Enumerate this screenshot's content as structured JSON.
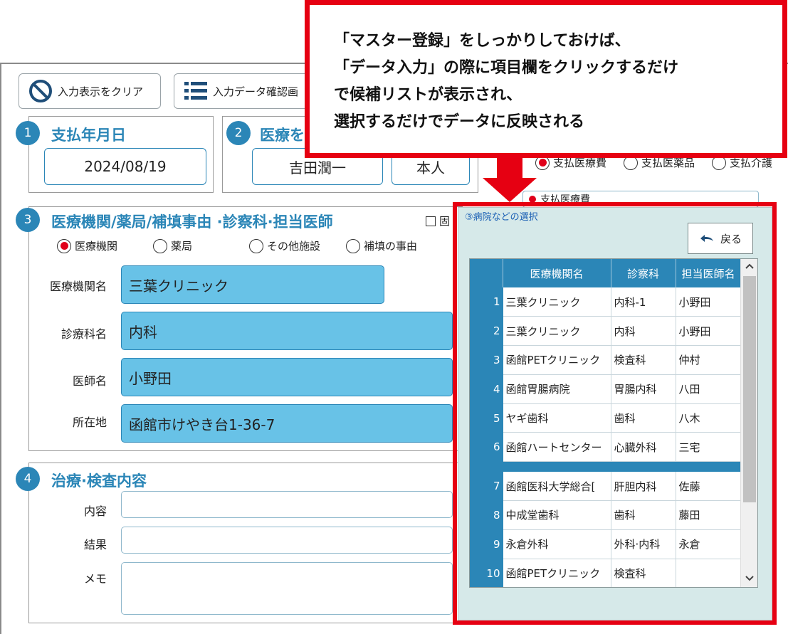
{
  "toolbar": {
    "clear_label": "入力表示をクリア",
    "confirm_label": "入力データ確認画"
  },
  "section1": {
    "num": "1",
    "title": "支払年月日",
    "date": "2024/08/19"
  },
  "section2": {
    "num": "2",
    "title": "医療を",
    "person": "吉田潤一",
    "relation": "本人"
  },
  "payment": {
    "options": [
      "支払医療費",
      "支払医薬品",
      "支払介護"
    ],
    "selected_label": "支払医療費"
  },
  "section3": {
    "num": "3",
    "title": "医療機関/薬局/補填事由 ·診察科·担当医師",
    "checkbox_label": "固",
    "radios": [
      "医療機関",
      "薬局",
      "その他施設",
      "補填の事由"
    ],
    "selected_radio": "医療機関",
    "fields": [
      {
        "label": "医療機関名",
        "value": "三葉クリニック"
      },
      {
        "label": "診療科名",
        "value": "内科"
      },
      {
        "label": "医師名",
        "value": "小野田"
      },
      {
        "label": "所在地",
        "value": "函館市けやき台1-36-7"
      }
    ]
  },
  "section4": {
    "num": "4",
    "title": "治療·検査内容",
    "labels": [
      "内容",
      "結果",
      "メモ"
    ]
  },
  "callout": {
    "lines": [
      "「マスター登録」をしっかりしておけば、",
      "「データ入力」の際に項目欄をクリックするだけ",
      "で候補リストが表示され、",
      "選択するだけでデータに反映される"
    ]
  },
  "popup": {
    "title": "③病院などの選択",
    "back_label": "戻る",
    "columns": [
      "医療機関名",
      "診察科",
      "担当医師名"
    ],
    "rows": [
      [
        "1",
        "三葉クリニック",
        "内科-1",
        "小野田"
      ],
      [
        "2",
        "三葉クリニック",
        "内科",
        "小野田"
      ],
      [
        "3",
        "函館PETクリニック",
        "検査科",
        "仲村"
      ],
      [
        "4",
        "函館胃腸病院",
        "胃腸内科",
        "八田"
      ],
      [
        "5",
        "ヤギ歯科",
        "歯科",
        "八木"
      ],
      [
        "6",
        "函館ハートセンター",
        "心臓外科",
        "三宅"
      ],
      [
        "7",
        "函館医科大学総合[",
        "肝胆内科",
        "佐藤"
      ],
      [
        "8",
        "中成堂歯科",
        "歯科",
        "藤田"
      ],
      [
        "9",
        "永倉外科",
        "外科·内科",
        "永倉"
      ],
      [
        "10",
        "函館PETクリニック",
        "検査科",
        ""
      ]
    ]
  },
  "colors": {
    "accent": "#2b86b7",
    "field_fill": "#68c2e7",
    "highlight": "#e60012",
    "popup_bg": "#d6e9e9"
  }
}
